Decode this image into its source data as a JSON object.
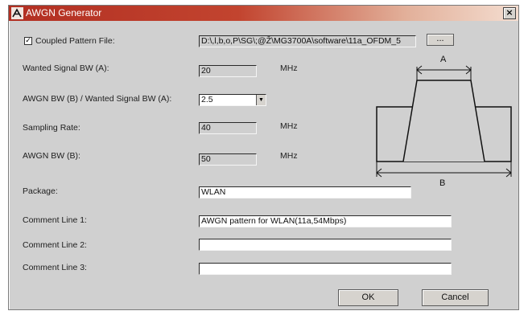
{
  "window": {
    "title": "AWGN Generator",
    "close_label": "×"
  },
  "form": {
    "coupled_pattern": {
      "label": "Coupled Pattern File:",
      "checked": true,
      "check_mark": "✓",
      "value": "D:\\,l,b,o,P\\SG\\;@Ž\\MG3700A\\software\\11a_OFDM_5",
      "browse_label": "..."
    },
    "wanted_bw": {
      "label": "Wanted Signal BW (A):",
      "value": "20",
      "unit": "MHz"
    },
    "ratio": {
      "label": "AWGN BW (B) / Wanted Signal BW (A):",
      "value": "2.5",
      "arrow": "▼"
    },
    "sampling_rate": {
      "label": "Sampling Rate:",
      "value": "40",
      "unit": "MHz"
    },
    "awgn_bw": {
      "label": "AWGN BW (B):",
      "value": "50",
      "unit": "MHz"
    },
    "package": {
      "label": "Package:",
      "value": "WLAN"
    },
    "comment1": {
      "label": "Comment Line 1:",
      "value": "AWGN pattern for WLAN(11a,54Mbps)"
    },
    "comment2": {
      "label": "Comment Line 2:",
      "value": ""
    },
    "comment3": {
      "label": "Comment Line 3:",
      "value": ""
    }
  },
  "diagram": {
    "label_a": "A",
    "label_b": "B"
  },
  "buttons": {
    "ok": "OK",
    "cancel": "Cancel"
  }
}
